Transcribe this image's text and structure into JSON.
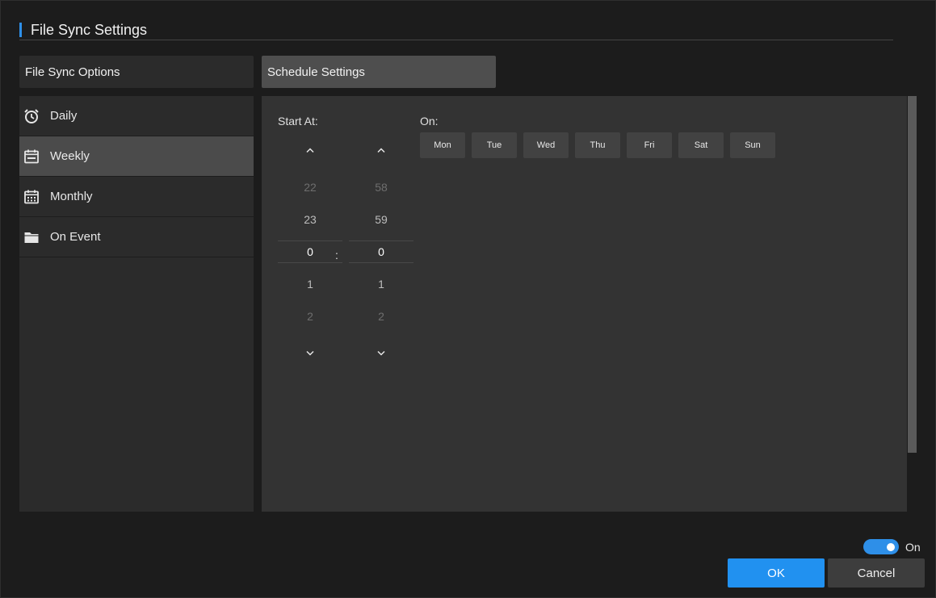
{
  "window": {
    "title": "File Sync Settings"
  },
  "headers": {
    "options": "File Sync Options",
    "schedule": "Schedule Settings"
  },
  "nav": {
    "items": [
      {
        "label": "Daily",
        "icon": "alarm-clock-icon",
        "active": false
      },
      {
        "label": "Weekly",
        "icon": "calendar-week-icon",
        "active": true
      },
      {
        "label": "Monthly",
        "icon": "calendar-month-icon",
        "active": false
      },
      {
        "label": "On Event",
        "icon": "folder-icon",
        "active": false
      }
    ]
  },
  "schedule": {
    "start_label": "Start At:",
    "on_label": "On:",
    "separator": ":",
    "hours": {
      "prev2": "22",
      "prev1": "23",
      "value": "0",
      "next1": "1",
      "next2": "2"
    },
    "minutes": {
      "prev2": "58",
      "prev1": "59",
      "value": "0",
      "next1": "1",
      "next2": "2"
    },
    "days": [
      "Mon",
      "Tue",
      "Wed",
      "Thu",
      "Fri",
      "Sat",
      "Sun"
    ]
  },
  "toggle": {
    "label": "On",
    "enabled": true
  },
  "buttons": {
    "ok": "OK",
    "cancel": "Cancel"
  },
  "colors": {
    "accent": "#2e8fe8",
    "ok_button": "#2191f0",
    "background": "#1c1c1c",
    "panel": "#333333"
  }
}
